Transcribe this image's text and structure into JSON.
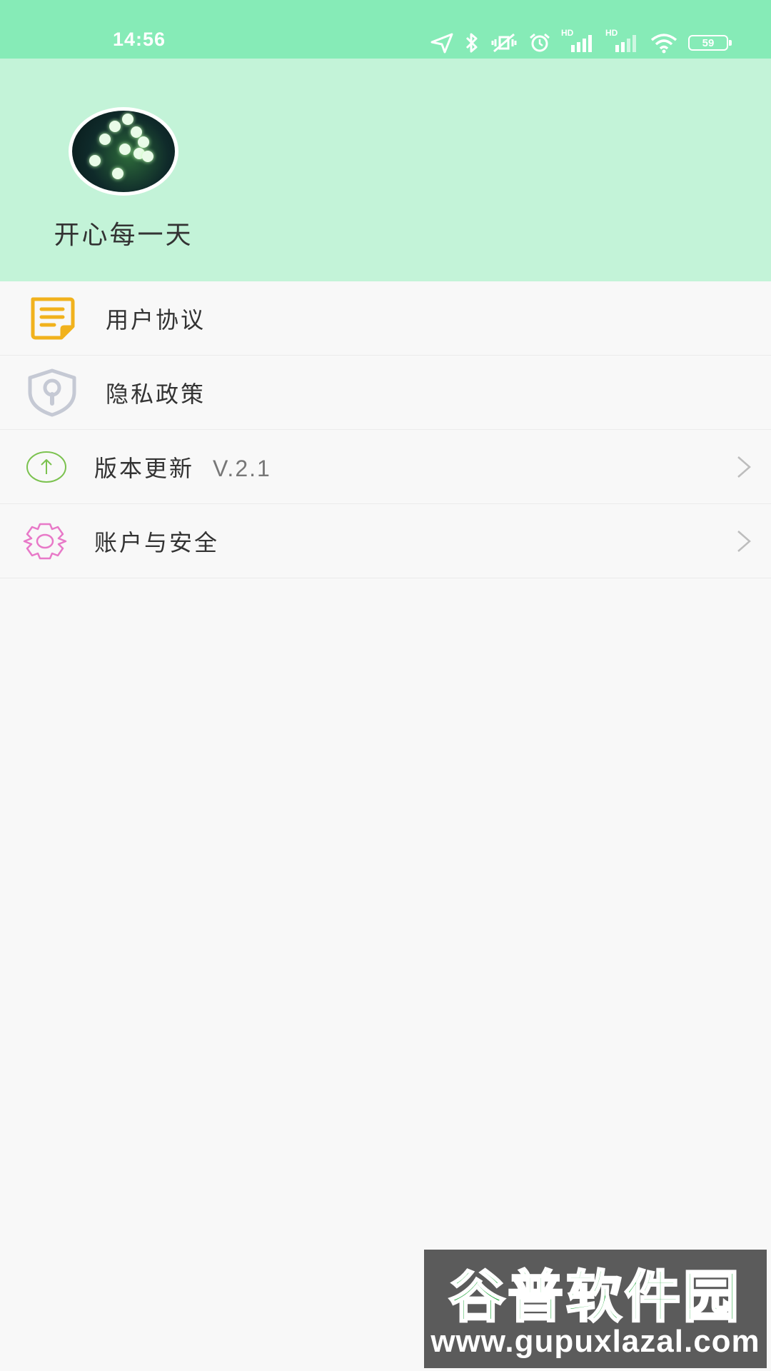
{
  "status_bar": {
    "time": "14:56",
    "hd_label_1": "HD",
    "hd_label_2": "HD",
    "battery_level": "59"
  },
  "profile": {
    "username": "开心每一天"
  },
  "menu": {
    "items": [
      {
        "label": "用户协议",
        "icon": "document-icon",
        "color": "#f1b21d"
      },
      {
        "label": "隐私政策",
        "icon": "shield-lock-icon",
        "color": "#c5c9d4"
      },
      {
        "label": "版本更新",
        "version": "V.2.1",
        "icon": "upload-circle-icon",
        "color": "#7bc24f"
      },
      {
        "label": "账户与安全",
        "icon": "gear-icon",
        "color": "#e879c8"
      }
    ]
  },
  "watermark": {
    "title": "谷普软件园",
    "url": "www.gupuxlazal.com"
  },
  "colors": {
    "status_bar": "#86ebb7",
    "header": "#c3f3d8",
    "background": "#f8f8f8"
  }
}
